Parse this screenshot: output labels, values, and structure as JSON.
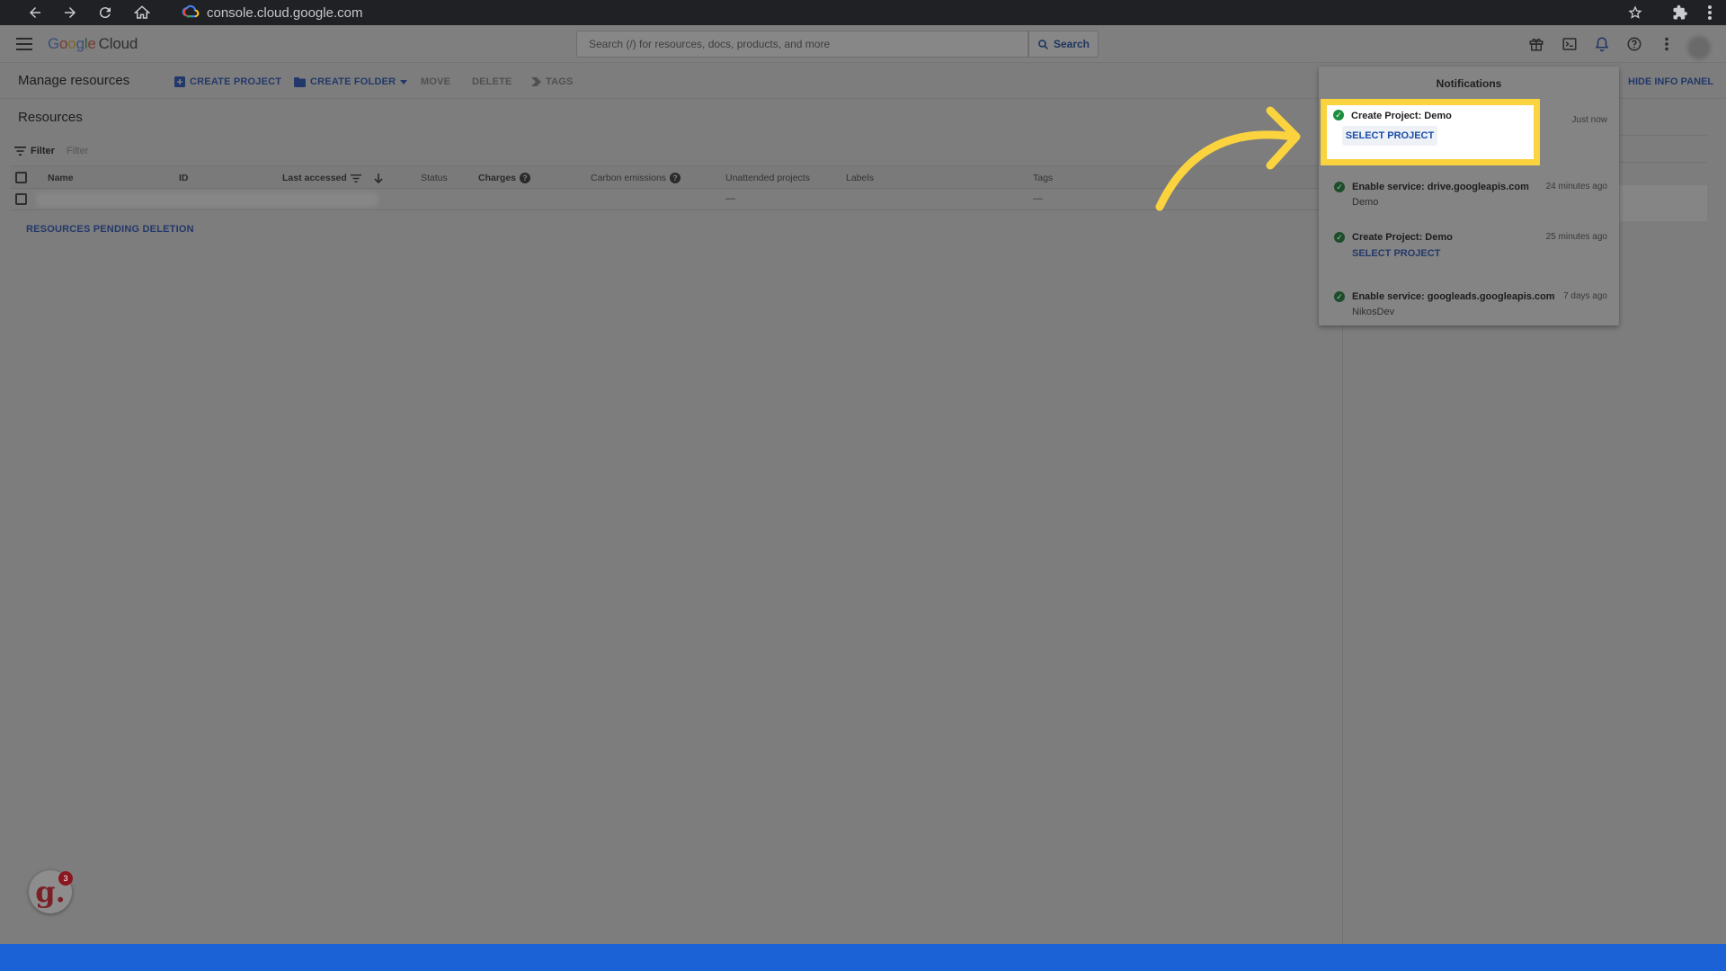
{
  "browser": {
    "url": "console.cloud.google.com",
    "icons": [
      "back-arrow-icon",
      "forward-arrow-icon",
      "reload-icon",
      "home-icon",
      "star-icon",
      "extension-puzzle-icon",
      "kebab-menu-icon"
    ]
  },
  "header": {
    "brand_g1": "G",
    "brand_o1": "o",
    "brand_o2": "o",
    "brand_g2": "g",
    "brand_l": "l",
    "brand_e": "e",
    "brand_cloud": "Cloud",
    "search_placeholder": "Search (/) for resources, docs, products, and more",
    "search_button": "Search",
    "icons": [
      "gift-icon",
      "cloud-shell-icon",
      "bell-icon",
      "help-icon",
      "kebab-icon"
    ]
  },
  "toolbar": {
    "title": "Manage resources",
    "create_project": "CREATE PROJECT",
    "create_folder": "CREATE FOLDER",
    "move": "MOVE",
    "delete": "DELETE",
    "tags": "TAGS",
    "hide_info_panel": "HIDE INFO PANEL"
  },
  "resources": {
    "title": "Resources",
    "filter_label": "Filter",
    "filter_placeholder": "Filter",
    "columns": [
      "Name",
      "ID",
      "Last accessed",
      "Status",
      "Charges",
      "Carbon emissions",
      "Unattended projects",
      "Labels",
      "Tags"
    ],
    "row": {
      "unattended": "—",
      "tags": "—"
    },
    "pending_deletion": "RESOURCES PENDING DELETION"
  },
  "notifications": {
    "title": "Notifications",
    "items": [
      {
        "title": "Create Project: Demo",
        "action": "SELECT PROJECT",
        "time": "Just now"
      },
      {
        "title": "Enable service: drive.googleapis.com",
        "sub": "Demo",
        "time": "24 minutes ago"
      },
      {
        "title": "Create Project: Demo",
        "action": "SELECT PROJECT",
        "time": "25 minutes ago"
      },
      {
        "title": "Enable service: googleads.googleapis.com",
        "sub": "NikosDev",
        "time": "7 days ago"
      }
    ]
  },
  "guide_widget": {
    "letter": "g.",
    "count": "3"
  },
  "colors": {
    "highlight": "#fbd33f",
    "arrow": "#fbd33f",
    "bottom_bar": "#1a62d6",
    "success": "#1e8e3e",
    "link": "#1a4ba8"
  }
}
